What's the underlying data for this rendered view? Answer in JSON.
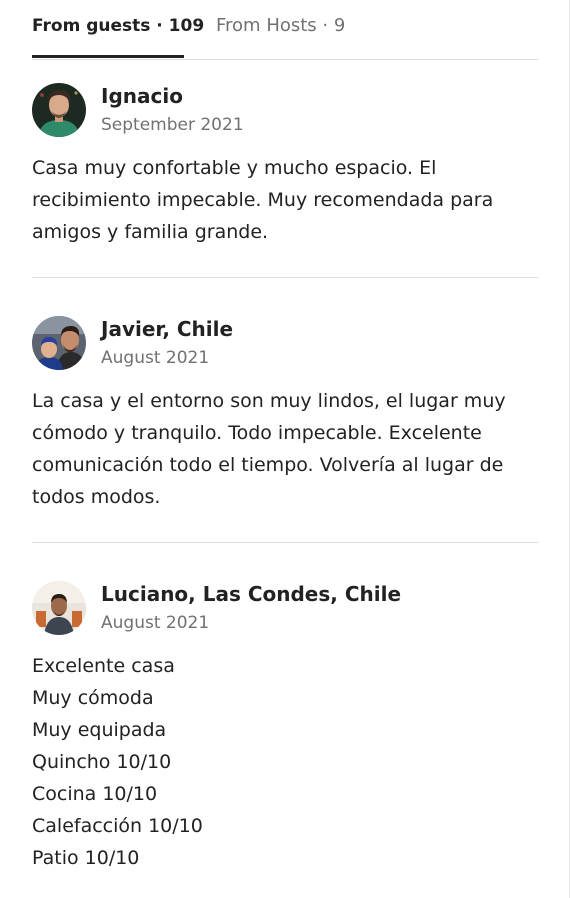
{
  "tabs": {
    "guests_label": "From guests · 109",
    "hosts_label": "From Hosts · 9"
  },
  "reviews": [
    {
      "name": "Ignacio",
      "date": "September 2021",
      "lines": [
        "Casa muy confortable y mucho espacio. El",
        "recibimiento impecable. Muy recomendada para",
        "amigos y familia grande."
      ]
    },
    {
      "name": "Javier, Chile",
      "date": "August 2021",
      "lines": [
        "La casa y el entorno son muy lindos, el lugar muy",
        "cómodo y tranquilo. Todo impecable. Excelente",
        "comunicación todo el tiempo. Volvería al lugar de",
        "todos modos."
      ]
    },
    {
      "name": "Luciano, Las Condes, Chile",
      "date": "August 2021",
      "lines": [
        "Excelente casa",
        "Muy cómoda",
        "Muy equipada",
        "Quincho 10/10",
        "Cocina 10/10",
        "Calefacción 10/10",
        "Patio 10/10"
      ]
    }
  ]
}
